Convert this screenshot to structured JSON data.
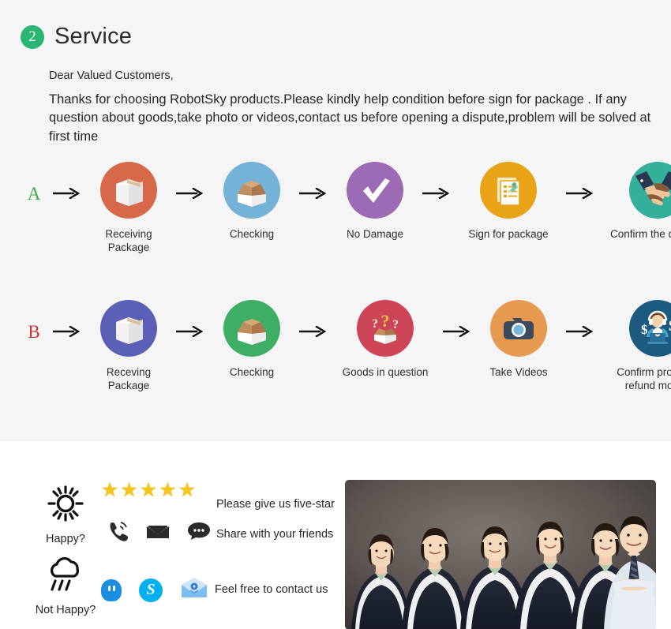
{
  "section": {
    "badge": "2",
    "title": "Service"
  },
  "intro": {
    "salutation": "Dear Valued Customers,",
    "body": "Thanks for choosing RobotSky products.Please kindly help condition before sign for package . If any question about goods,take photo or videos,contact us before opening a dispute,problem will be solved at first time"
  },
  "colors": {
    "section_bg": "#f5f5f5",
    "badge_green": "#2bb573",
    "label_a": "#33aa44",
    "label_b": "#cc3333",
    "receiving_orange": "#d7694a",
    "checking_blue": "#75b2d8",
    "nodamage_purple": "#9b6bb5",
    "sign_amber": "#e8a317",
    "confirm_teal": "#34b09a",
    "receiving_indigo": "#5b5fb5",
    "checking_green": "#3dae63",
    "question_red": "#cc4455",
    "camera_orange": "#e59a50",
    "support_navy": "#1d5a80",
    "star_yellow": "#f5c518",
    "skype_blue": "#00aff0",
    "qq_blue": "#1a8fe0"
  },
  "flows": [
    {
      "label": "A",
      "label_color_name": "green",
      "steps": [
        {
          "icon": "package-box-icon",
          "label": "Receiving Package"
        },
        {
          "icon": "open-box-icon",
          "label": "Checking"
        },
        {
          "icon": "checkmark-icon",
          "label": "No Damage"
        },
        {
          "icon": "signed-document-icon",
          "label": "Sign for package"
        },
        {
          "icon": "handshake-icon",
          "label": "Confirm the delivery"
        }
      ]
    },
    {
      "label": "B",
      "label_color_name": "red",
      "steps": [
        {
          "icon": "package-box-icon",
          "label": "Receving Package"
        },
        {
          "icon": "open-box-icon",
          "label": "Checking"
        },
        {
          "icon": "question-box-icon",
          "label": "Goods in question"
        },
        {
          "icon": "camera-icon",
          "label": "Take Videos"
        },
        {
          "icon": "customer-support-icon",
          "label": "Confirm problem,\nrefund money"
        }
      ]
    }
  ],
  "contact": {
    "happy_label": "Happy?",
    "not_happy_label": "Not Happy?",
    "star_count": 5,
    "star_glyph": "★",
    "msg_five_star": "Please give us five-star",
    "msg_share": "Share with your friends",
    "msg_contact": "Feel free to contact us",
    "social_icons": [
      "phone-ring-icon",
      "envelope-icon",
      "chat-bubble-icon"
    ],
    "im_icons": [
      "qq-icon",
      "skype-icon",
      "email-open-icon"
    ],
    "photo_alt": "team-photo"
  }
}
